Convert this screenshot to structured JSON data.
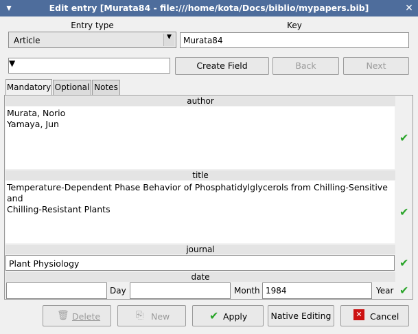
{
  "window": {
    "title": "Edit entry [Murata84 - file:///home/kota/Docs/biblio/mypapers.bib]",
    "menu_icon": "window-menu-icon",
    "close_icon": "close-icon"
  },
  "header": {
    "entry_type_label": "Entry type",
    "entry_type_value": "Article",
    "key_label": "Key",
    "key_value": "Murata84"
  },
  "field_tools": {
    "field_combo_value": "",
    "create_field": "Create Field",
    "back": "Back",
    "next": "Next"
  },
  "tabs": [
    {
      "label": "Mandatory",
      "active": true
    },
    {
      "label": "Optional",
      "active": false
    },
    {
      "label": "Notes",
      "active": false
    }
  ],
  "fields": {
    "author": {
      "label": "author",
      "value": "Murata, Norio\nYamaya, Jun"
    },
    "title": {
      "label": "title",
      "value": "Temperature-Dependent Phase Behavior of Phosphatidylglycerols from Chilling-Sensitive and\nChilling-Resistant Plants"
    },
    "journal": {
      "label": "journal",
      "value": "Plant Physiology"
    },
    "date": {
      "label": "date",
      "day_label": "Day",
      "day_value": "",
      "month_label": "Month",
      "month_value": "",
      "year_label": "Year",
      "year_value": "1984"
    }
  },
  "buttons": {
    "delete": "Delete",
    "new": "New",
    "apply": "Apply",
    "native_editing": "Native Editing",
    "cancel": "Cancel"
  },
  "colors": {
    "titlebar": "#4e6d9c",
    "check": "#2aa52a",
    "cancel_x": "#cc1111"
  }
}
